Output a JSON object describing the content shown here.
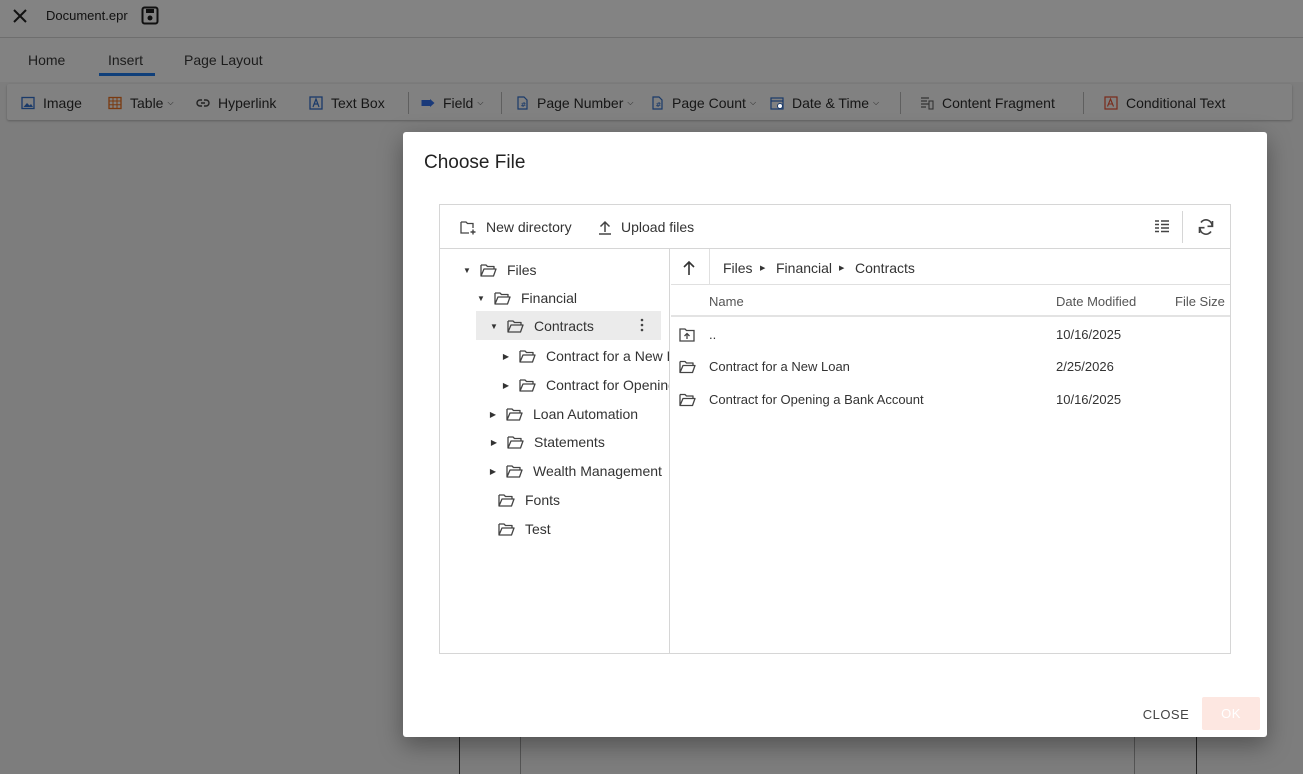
{
  "app": {
    "document_title": "Document.epr"
  },
  "tabs": [
    {
      "label": "Home"
    },
    {
      "label": "Insert",
      "active": true
    },
    {
      "label": "Page Layout"
    }
  ],
  "toolbar": {
    "image": "Image",
    "table": "Table",
    "hyperlink": "Hyperlink",
    "text_box": "Text Box",
    "field": "Field",
    "page_number": "Page Number",
    "page_count": "Page Count",
    "date_time": "Date & Time",
    "content_fragment": "Content Fragment",
    "conditional_text": "Conditional Text"
  },
  "dialog": {
    "title": "Choose File",
    "new_directory": "New directory",
    "upload_files": "Upload files",
    "close_label": "CLOSE",
    "ok_label": "OK"
  },
  "tree": [
    {
      "label": "Files",
      "level": 0,
      "expanded": true
    },
    {
      "label": "Financial",
      "level": 1,
      "expanded": true
    },
    {
      "label": "Contracts",
      "level": 2,
      "expanded": true,
      "selected": true
    },
    {
      "label": "Contract for a New Loan",
      "level": 3,
      "expanded": false
    },
    {
      "label": "Contract for Opening a Bank Account",
      "level": 3,
      "expanded": false
    },
    {
      "label": "Loan Automation",
      "level": 2,
      "expanded": false
    },
    {
      "label": "Statements",
      "level": 2,
      "expanded": false
    },
    {
      "label": "Wealth Management",
      "level": 2,
      "expanded": false
    },
    {
      "label": "Fonts",
      "level": 1
    },
    {
      "label": "Test",
      "level": 1
    }
  ],
  "breadcrumb": [
    "Files",
    "Financial",
    "Contracts"
  ],
  "columns": {
    "name": "Name",
    "date_modified": "Date Modified",
    "file_size": "File Size"
  },
  "rows": [
    {
      "name": "..",
      "date": "10/16/2025",
      "icon": "folder-up-icon"
    },
    {
      "name": "Contract for a New Loan",
      "date": "2/25/2026",
      "icon": "folder-open-icon"
    },
    {
      "name": "Contract for Opening a Bank Account",
      "date": "10/16/2025",
      "icon": "folder-open-icon"
    }
  ],
  "colors": {
    "accent": "#0f3f7a",
    "ok_disabled": "#fde7e1"
  }
}
